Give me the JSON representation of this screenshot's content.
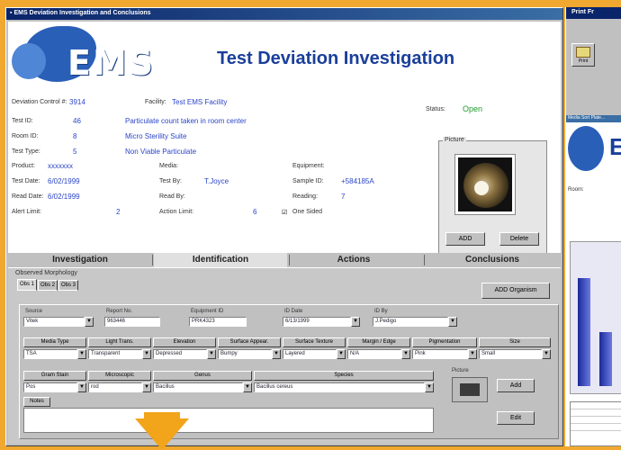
{
  "window": {
    "title": "EMS Deviation Investigation and Conclusions"
  },
  "header": {
    "logo_text": "EMS",
    "title": "Test Deviation Investigation"
  },
  "record": {
    "control_label": "Deviation Control #:",
    "control_value": "3914",
    "facility_label": "Facility:",
    "facility_value": "Test EMS Facility",
    "status_label": "Status:",
    "status_value": "Open",
    "testid_label": "Test ID:",
    "testid_value": "46",
    "testid_desc": "Particulate count taken in room center",
    "room_label": "Room ID:",
    "room_value": "8",
    "room_desc": "Micro Sterility Suite",
    "testtype_label": "Test Type:",
    "testtype_value": "5",
    "testtype_desc": "Non Viable Particulate",
    "product_label": "Product:",
    "product_value": "xxxxxxx",
    "media_label": "Media:",
    "equipment_label": "Equipment:",
    "testdate_label": "Test Date:",
    "testdate_value": "6/02/1999",
    "testby_label": "Test By:",
    "testby_value": "T.Joyce",
    "sampleid_label": "Sample ID:",
    "sampleid_value": "+584185A",
    "readdate_label": "Read Date:",
    "readdate_value": "6/02/1999",
    "readby_label": "Read By:",
    "reading_label": "Reading:",
    "reading_value": "7",
    "alert_label": "Alert Limit:",
    "alert_value": "2",
    "action_label": "Action Limit:",
    "action_value": "6",
    "onesided_label": "One Sided"
  },
  "picture_group": {
    "label": "Picture",
    "add_label": "ADD",
    "delete_label": "Delete"
  },
  "tabs": [
    {
      "label": "Investigation"
    },
    {
      "label": "Identification"
    },
    {
      "label": "Actions"
    },
    {
      "label": "Conclusions"
    }
  ],
  "identification": {
    "morph_label": "Observed Morphology",
    "subtabs": [
      {
        "label": "Obs 1"
      },
      {
        "label": "Obs 2"
      },
      {
        "label": "Obs 3"
      }
    ],
    "add_organism_label": "ADD Organism",
    "row1_headers": {
      "source": "Source",
      "report": "Report No.",
      "equipment": "Equipment ID",
      "iddate": "ID Date",
      "idby": "ID By"
    },
    "row1_values": {
      "source": "Vitek",
      "report": "963446",
      "equipment": "PRK4323",
      "iddate": "6/13/1999",
      "idby": "J.Pedigo"
    },
    "row2_headers": [
      "Media Type",
      "Light Trans.",
      "Elevation",
      "Surface Appear.",
      "Surface Texture",
      "Margin / Edge",
      "Pigmentation",
      "Size"
    ],
    "row2_values": [
      "TSA",
      "Transparent",
      "Depressed",
      "Bumpy",
      "Layered",
      "N/A",
      "Pink",
      "Small"
    ],
    "row3_headers": {
      "gram": "Gram Stain",
      "micro": "Microscopic",
      "genus": "Genus",
      "species": "Species"
    },
    "row3_values": {
      "gram": "Pos",
      "micro": "rod",
      "genus": "Bacillus",
      "species": "Bacillus cereus"
    },
    "notes_label": "Notes",
    "picture_label": "Picture",
    "add_label": "Add",
    "edit_label": "Edit"
  },
  "right_window": {
    "title": "Print Fr",
    "tool_label": "Print",
    "inner_title": "Media Sort Plate...",
    "logo_letter": "E",
    "room_label": "Room:"
  },
  "colors": {
    "brand_blue": "#1a3f9a",
    "status_green": "#1f9b2c",
    "accent_orange": "#f2a41a"
  }
}
